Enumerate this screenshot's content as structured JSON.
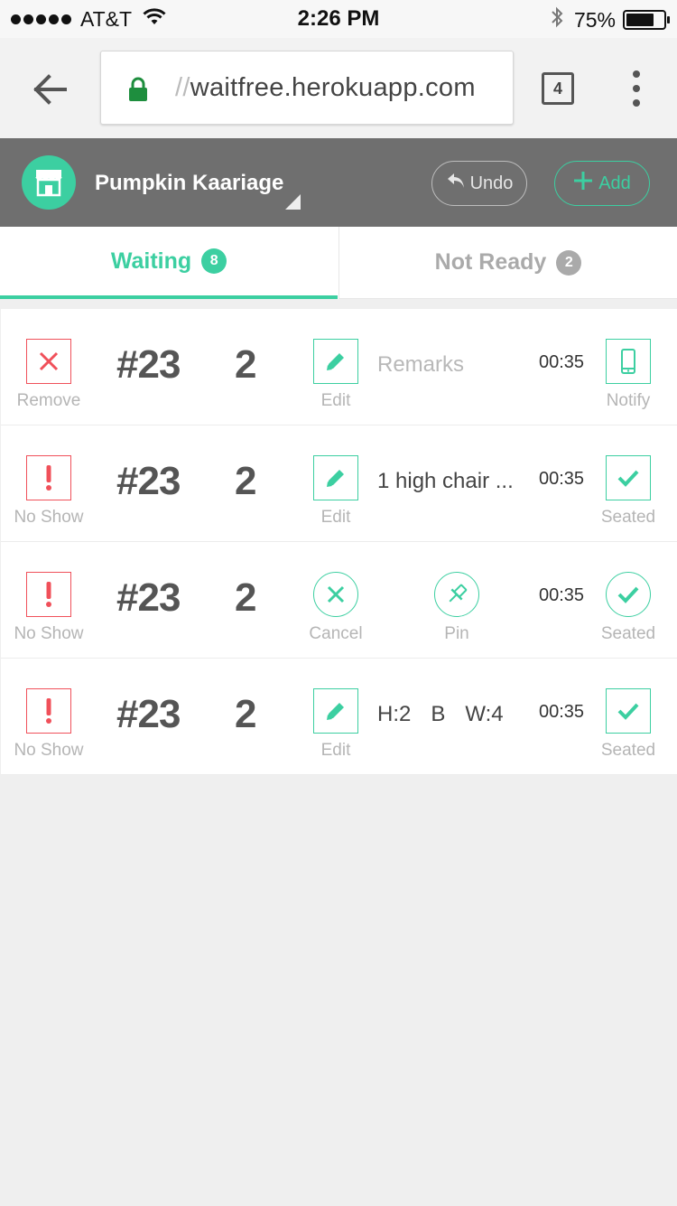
{
  "status_bar": {
    "carrier": "AT&T",
    "time": "2:26 PM",
    "battery": "75%",
    "battery_level": 0.75
  },
  "browser": {
    "url_scheme": "//",
    "url_host": "waitfree.herokuapp.com",
    "tab_count": "4"
  },
  "header": {
    "store_name": "Pumpkin Kaariage",
    "undo_label": "Undo",
    "add_label": "Add"
  },
  "tabs": [
    {
      "label": "Waiting",
      "count": "8"
    },
    {
      "label": "Not Ready",
      "count": "2"
    }
  ],
  "queue": [
    {
      "left_action": "Remove",
      "ticket": "#23",
      "party_size": "2",
      "middle_action": "Edit",
      "remarks": "Remarks",
      "time": "00:35",
      "right_action": "Notify"
    },
    {
      "left_action": "No Show",
      "ticket": "#23",
      "party_size": "2",
      "middle_action": "Edit",
      "remarks": "1 high chair ...",
      "time": "00:35",
      "right_action": "Seated"
    },
    {
      "left_action": "No Show",
      "ticket": "#23",
      "party_size": "2",
      "middle_action": "Cancel",
      "pin_action": "Pin",
      "time": "00:35",
      "right_action": "Seated"
    },
    {
      "left_action": "No Show",
      "ticket": "#23",
      "party_size": "2",
      "middle_action": "Edit",
      "tags": [
        "H:2",
        "B",
        "W:4"
      ],
      "time": "00:35",
      "right_action": "Seated"
    }
  ],
  "colors": {
    "accent": "#3ccfa1",
    "danger": "#f0505a",
    "header_bg": "#6f6f6f",
    "muted": "#b5b5b5"
  }
}
